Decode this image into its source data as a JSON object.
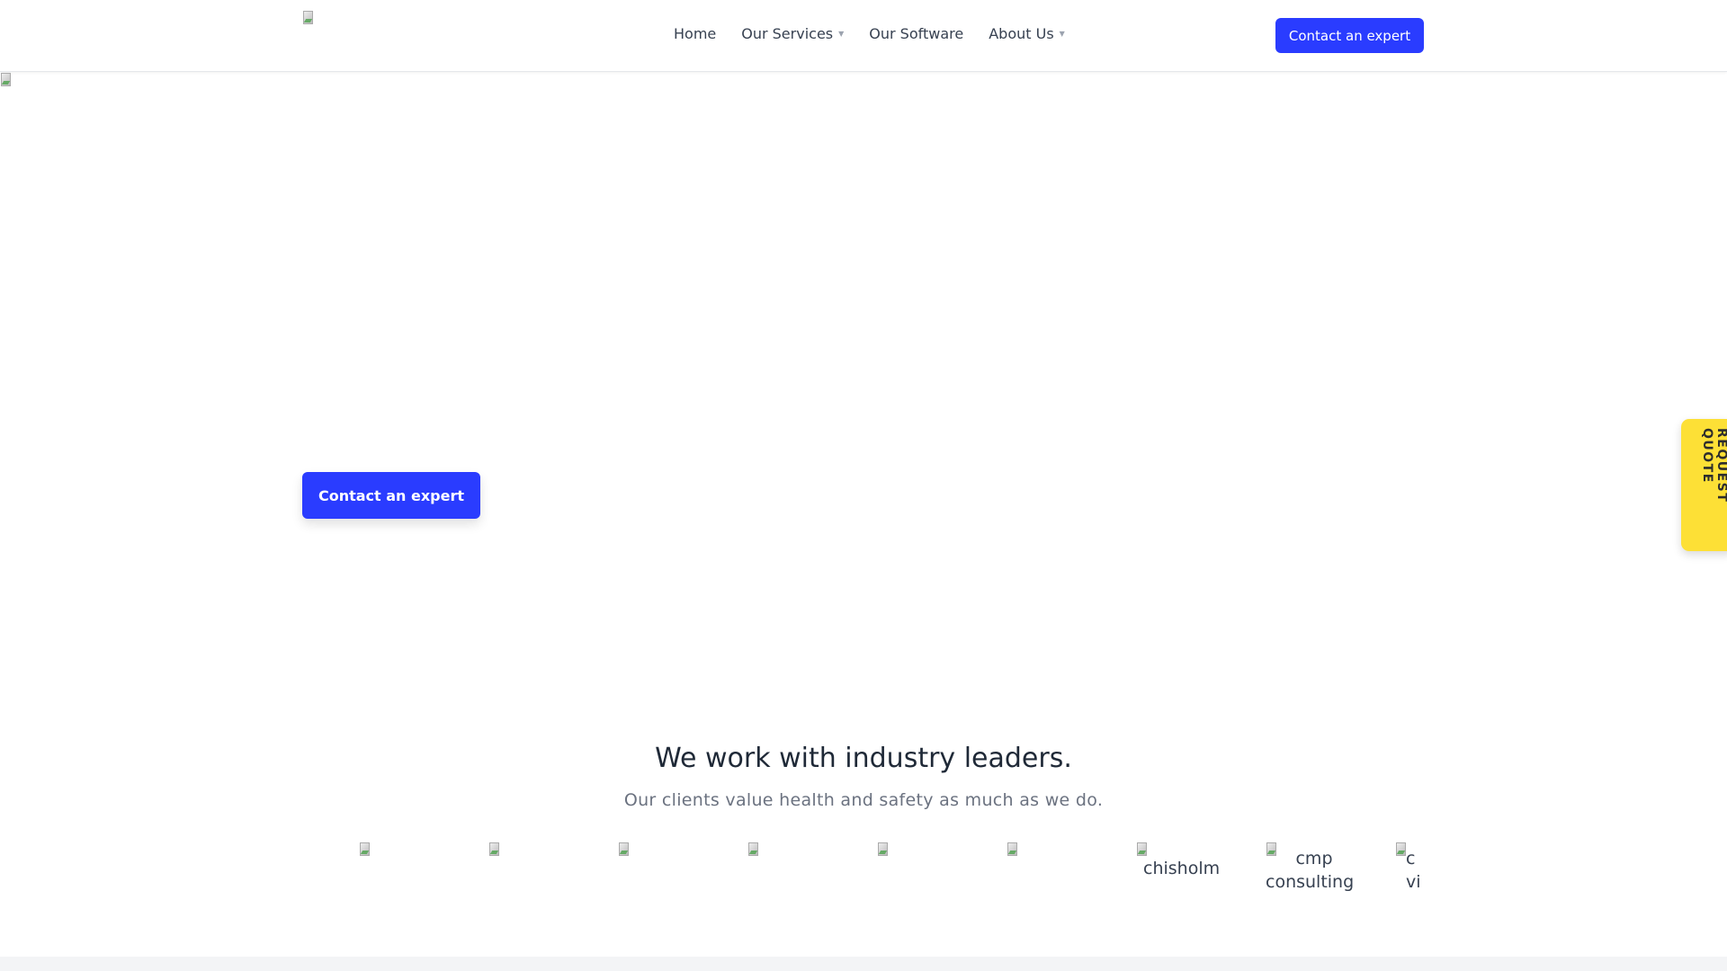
{
  "nav": {
    "links": [
      {
        "label": "Home",
        "dropdown": false
      },
      {
        "label": "Our Services",
        "dropdown": true
      },
      {
        "label": "Our Software",
        "dropdown": false
      },
      {
        "label": "About Us",
        "dropdown": true
      }
    ],
    "cta": "Contact an expert"
  },
  "hero": {
    "cta": "Contact an expert"
  },
  "quote_tab": "REQUEST QUOTE",
  "clients": {
    "title": "We work with industry leaders.",
    "subtitle": "Our clients value health and safety as much as we do.",
    "logos": [
      "",
      "",
      "",
      "",
      "",
      "",
      "chisholm",
      "cmp consulting",
      "c vi"
    ]
  },
  "colors": {
    "accent": "#2a3cff",
    "quote": "#fde036"
  }
}
